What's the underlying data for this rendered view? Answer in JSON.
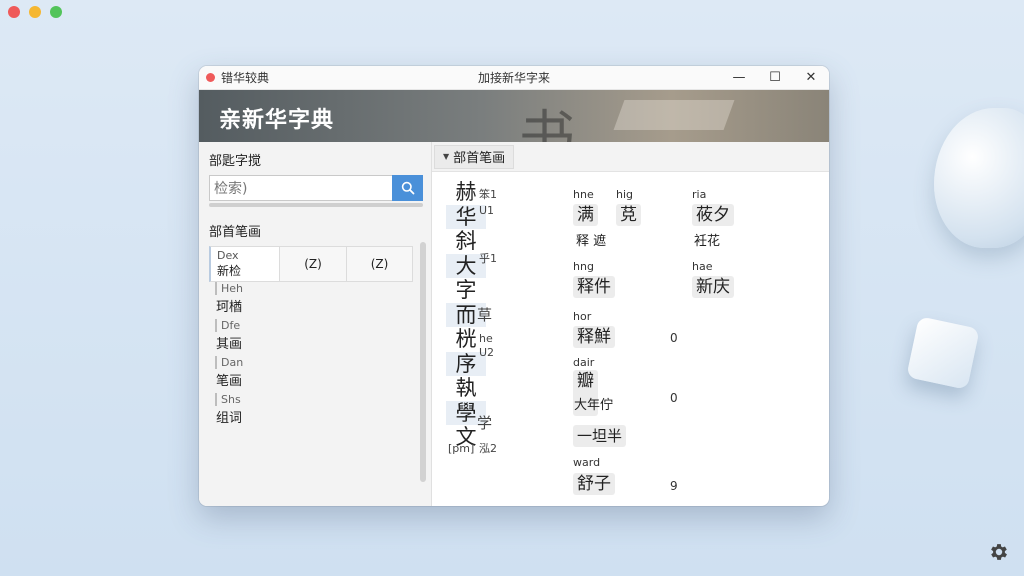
{
  "desktop": {
    "traffic_colors": [
      "#ef5a5a",
      "#f5b731",
      "#52c45a"
    ],
    "settings_icon": "gear-icon"
  },
  "window": {
    "app_name": "错华较典",
    "doc_title": "加接新华字来",
    "controls": {
      "minimize": "—",
      "maximize": "☐",
      "close": "✕"
    },
    "banner_title": "亲新华字典"
  },
  "sidebar": {
    "search_heading": "部匙字搅",
    "search_value": "检索)",
    "radical_heading": "部首笔画",
    "tabs": [
      {
        "top": "Dex",
        "main": "新检"
      },
      {
        "label": "(Z)"
      },
      {
        "label": "(Z)"
      }
    ],
    "items": [
      {
        "sub": "Heh",
        "main": "珂楢"
      },
      {
        "sub": "Dfe",
        "main": "其画"
      },
      {
        "sub": "Dan",
        "main": "笔画"
      },
      {
        "sub": "Shs",
        "main": "组词"
      }
    ]
  },
  "content": {
    "section_tab": "部首笔画",
    "chars": [
      "赫",
      "华",
      "斜",
      "大",
      "字",
      "而",
      "桄",
      "序",
      "執",
      "學",
      "文"
    ],
    "highlighted": [
      1,
      3,
      5,
      7,
      9
    ],
    "annotations": [
      {
        "text": "笨1"
      },
      {
        "text": "U1"
      },
      {
        "text": "乎1"
      },
      {
        "text": "草"
      },
      {
        "text": "he"
      },
      {
        "text": "U2"
      },
      {
        "text": "学"
      },
      {
        "text": "[pm]"
      },
      {
        "text": "泓2"
      }
    ],
    "col2": {
      "labels": [
        "hne",
        "hng",
        "hor",
        "dair",
        "ward"
      ],
      "chips": [
        "满",
        "释件",
        "释鮮",
        "瓣",
        "一坦半",
        "舒子"
      ],
      "plain": [
        "释 遮",
        "大年佇"
      ],
      "numbers": [
        "0",
        "0",
        "9"
      ]
    },
    "col2b": {
      "label": "hig",
      "chip": "莌"
    },
    "col3": {
      "labels": [
        "ria",
        "hae"
      ],
      "chips": [
        "莜夕",
        "新庆"
      ],
      "plain": [
        "衽花"
      ]
    }
  }
}
